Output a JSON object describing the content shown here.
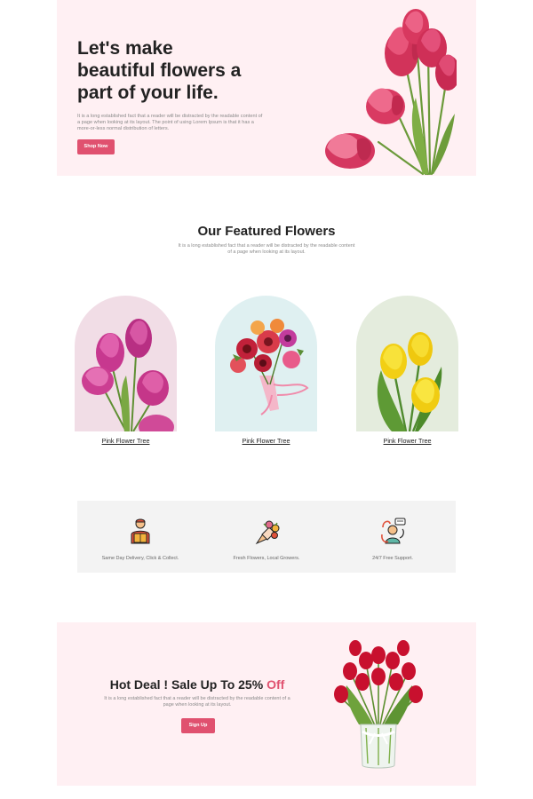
{
  "hero": {
    "title_line1": "Let's make",
    "title_line2": "beautiful flowers a",
    "title_line3": "part of your life.",
    "description": "It is a long established fact that a reader will be distracted by the readable content of a page when looking at its layout. The point of using Lorem Ipsum is that it has a more-or-less normal distribution of letters.",
    "button_label": "Shop Now"
  },
  "featured": {
    "title": "Our Featured Flowers",
    "subtitle": "It is a long established fact that a reader will be distracted by the readable content of a page when looking at its layout.",
    "cards": [
      {
        "label": "Pink Flower Tree",
        "bg": "#f1dde6"
      },
      {
        "label": "Pink Flower Tree",
        "bg": "#dff0f1"
      },
      {
        "label": "Pink Flower Tree",
        "bg": "#e4ecdd"
      }
    ]
  },
  "features": [
    {
      "icon": "delivery-person-icon",
      "text": "Same Day Delivery, Click & Collect."
    },
    {
      "icon": "flower-bouquet-icon",
      "text": "Fresh Flowers, Local Growers."
    },
    {
      "icon": "support-agent-icon",
      "text": "24/7 Free Support."
    }
  ],
  "deal": {
    "title_main": "Hot Deal ! Sale Up To 25% ",
    "title_accent": "Off",
    "description": "It is a long established fact that a reader will be distracted by the readable content of a page when looking at its layout.",
    "button_label": "Sign Up"
  },
  "colors": {
    "accent": "#e0516f",
    "section_pink": "#fff0f3",
    "features_bg": "#f3f3f3"
  }
}
